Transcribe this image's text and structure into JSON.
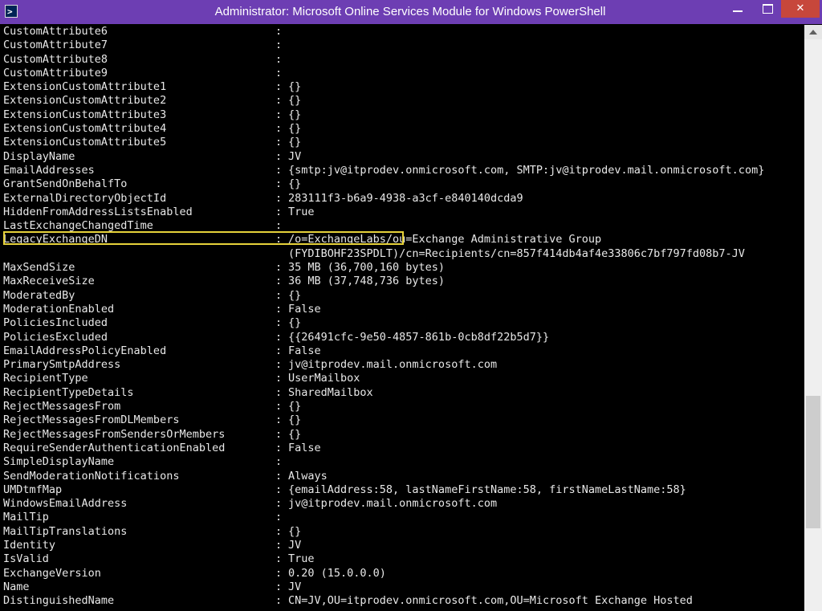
{
  "window": {
    "title": "Administrator: Microsoft Online Services Module for Windows PowerShell",
    "icon": "powershell-icon",
    "controls": {
      "minimize": "minimize-icon",
      "maximize": "maximize-icon",
      "close": "✕"
    }
  },
  "console": {
    "separator": ":",
    "highlight_color": "#e6d23a",
    "rows": [
      {
        "key": "CustomAttribute6",
        "value": ""
      },
      {
        "key": "CustomAttribute7",
        "value": ""
      },
      {
        "key": "CustomAttribute8",
        "value": ""
      },
      {
        "key": "CustomAttribute9",
        "value": ""
      },
      {
        "key": "ExtensionCustomAttribute1",
        "value": "{}"
      },
      {
        "key": "ExtensionCustomAttribute2",
        "value": "{}"
      },
      {
        "key": "ExtensionCustomAttribute3",
        "value": "{}"
      },
      {
        "key": "ExtensionCustomAttribute4",
        "value": "{}"
      },
      {
        "key": "ExtensionCustomAttribute5",
        "value": "{}"
      },
      {
        "key": "DisplayName",
        "value": "JV"
      },
      {
        "key": "EmailAddresses",
        "value": "{smtp:jv@itprodev.onmicrosoft.com, SMTP:jv@itprodev.mail.onmicrosoft.com}"
      },
      {
        "key": "GrantSendOnBehalfTo",
        "value": "{}"
      },
      {
        "key": "ExternalDirectoryObjectId",
        "value": "283111f3-b6a9-4938-a3cf-e840140dcda9"
      },
      {
        "key": "HiddenFromAddressListsEnabled",
        "value": "True"
      },
      {
        "key": "LastExchangeChangedTime",
        "value": ""
      },
      {
        "key": "LegacyExchangeDN",
        "value": "/o=ExchangeLabs/ou=Exchange Administrative Group"
      },
      {
        "key": "",
        "value": "(FYDIBOHF23SPDLT)/cn=Recipients/cn=857f414db4af4e33806c7bf797fd08b7-JV"
      },
      {
        "key": "MaxSendSize",
        "value": "35 MB (36,700,160 bytes)"
      },
      {
        "key": "MaxReceiveSize",
        "value": "36 MB (37,748,736 bytes)"
      },
      {
        "key": "ModeratedBy",
        "value": "{}"
      },
      {
        "key": "ModerationEnabled",
        "value": "False"
      },
      {
        "key": "PoliciesIncluded",
        "value": "{}"
      },
      {
        "key": "PoliciesExcluded",
        "value": "{{26491cfc-9e50-4857-861b-0cb8df22b5d7}}"
      },
      {
        "key": "EmailAddressPolicyEnabled",
        "value": "False"
      },
      {
        "key": "PrimarySmtpAddress",
        "value": "jv@itprodev.mail.onmicrosoft.com"
      },
      {
        "key": "RecipientType",
        "value": "UserMailbox"
      },
      {
        "key": "RecipientTypeDetails",
        "value": "SharedMailbox"
      },
      {
        "key": "RejectMessagesFrom",
        "value": "{}"
      },
      {
        "key": "RejectMessagesFromDLMembers",
        "value": "{}"
      },
      {
        "key": "RejectMessagesFromSendersOrMembers",
        "value": "{}"
      },
      {
        "key": "RequireSenderAuthenticationEnabled",
        "value": "False"
      },
      {
        "key": "SimpleDisplayName",
        "value": ""
      },
      {
        "key": "SendModerationNotifications",
        "value": "Always"
      },
      {
        "key": "UMDtmfMap",
        "value": "{emailAddress:58, lastNameFirstName:58, firstNameLastName:58}"
      },
      {
        "key": "WindowsEmailAddress",
        "value": "jv@itprodev.mail.onmicrosoft.com"
      },
      {
        "key": "MailTip",
        "value": ""
      },
      {
        "key": "MailTipTranslations",
        "value": "{}"
      },
      {
        "key": "Identity",
        "value": "JV"
      },
      {
        "key": "IsValid",
        "value": "True"
      },
      {
        "key": "ExchangeVersion",
        "value": "0.20 (15.0.0.0)"
      },
      {
        "key": "Name",
        "value": "JV"
      },
      {
        "key": "DistinguishedName",
        "value": "CN=JV,OU=itprodev.onmicrosoft.com,OU=Microsoft Exchange Hosted"
      }
    ]
  }
}
